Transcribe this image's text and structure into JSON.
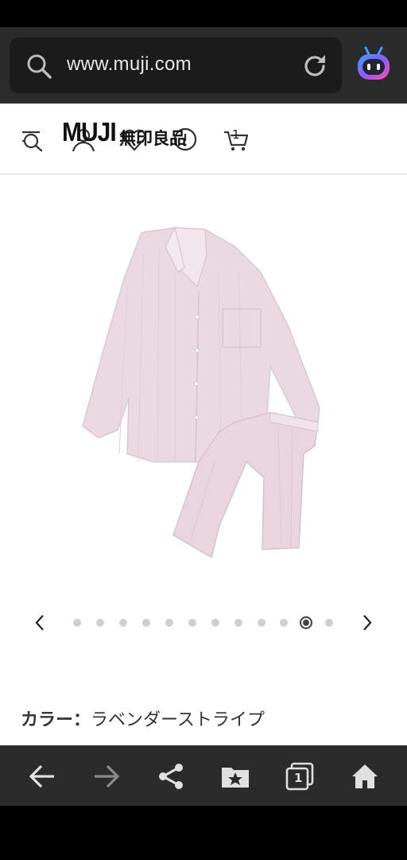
{
  "browser": {
    "url": "www.muji.com"
  },
  "header": {
    "logo_text": "MUJI",
    "logo_jp": "無印良品",
    "cart_count": "1"
  },
  "carousel": {
    "total_dots": 12,
    "active_index": 10
  },
  "product": {
    "color_label": "カラー：",
    "color_value": "ラベンダーストライプ"
  },
  "icons": {
    "search": "search-icon",
    "reload": "reload-icon",
    "assistant": "assistant-bot-icon",
    "menu_search": "menu-search-icon",
    "account": "account-icon",
    "wishlist": "heart-icon",
    "info": "info-icon",
    "cart": "cart-icon",
    "back": "back-arrow-icon",
    "forward": "forward-arrow-icon",
    "share": "share-icon",
    "bookmarks": "bookmark-folder-icon",
    "tabs": "tabs-icon",
    "home": "home-icon"
  },
  "tabs_count": "1",
  "colors": {
    "chrome_bg": "#2b2b2b",
    "urlbar_bg": "#1b1b1b",
    "page_bg": "#ffffff",
    "pajama_pink": "#ead9e2"
  }
}
